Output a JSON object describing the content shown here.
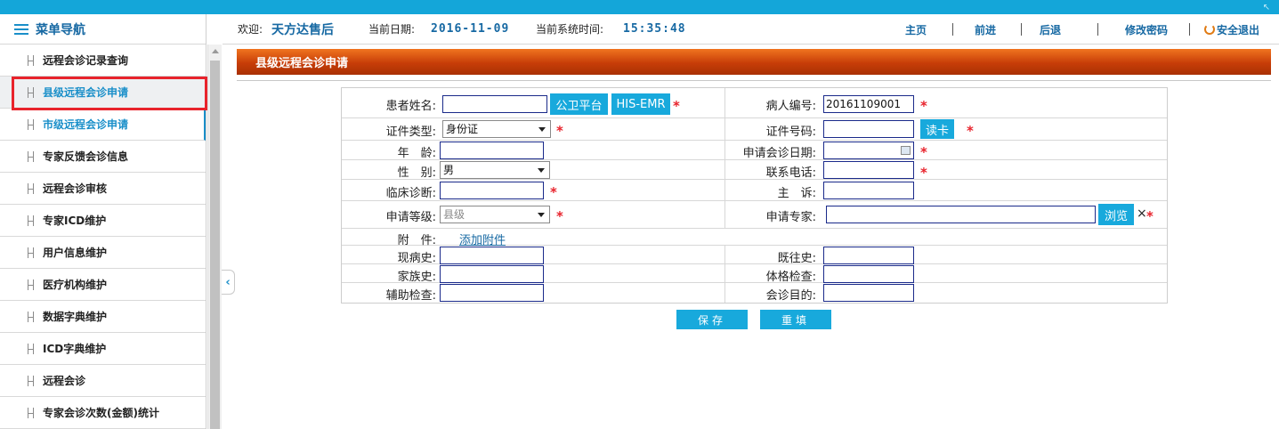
{
  "app": {
    "brand_color": "#14a6d9",
    "accent_color": "#1769a3",
    "required_color": "#e8232c",
    "title_bar_color": "#c73d08"
  },
  "sidebar": {
    "title": "菜单导航",
    "items": [
      {
        "label": "远程会诊记录查询"
      },
      {
        "label": "县级远程会诊申请"
      },
      {
        "label": "市级远程会诊申请"
      },
      {
        "label": "专家反馈会诊信息"
      },
      {
        "label": "远程会诊审核"
      },
      {
        "label": "专家ICD维护"
      },
      {
        "label": "用户信息维护"
      },
      {
        "label": "医疗机构维护"
      },
      {
        "label": "数据字典维护"
      },
      {
        "label": "ICD字典维护"
      },
      {
        "label": "远程会诊"
      },
      {
        "label": "专家会诊次数(金额)统计"
      }
    ]
  },
  "header": {
    "welcome_label": "欢迎:",
    "user": "天方达售后",
    "date_label": "当前日期:",
    "date": "2016-11-09",
    "time_label": "当前系统时间:",
    "time": "15:35:48",
    "nav": {
      "home": "主页",
      "forward": "前进",
      "back": "后退",
      "change_password": "修改密码",
      "logout": "安全退出"
    }
  },
  "page": {
    "title": "县级远程会诊申请"
  },
  "form": {
    "patient_name": {
      "label": "患者姓名:",
      "value": ""
    },
    "btn_gongwei": "公卫平台",
    "btn_his": "HIS-EMR",
    "patient_id": {
      "label": "病人编号:",
      "value": "20161109001"
    },
    "id_type": {
      "label": "证件类型:",
      "value": "身份证"
    },
    "id_number": {
      "label": "证件号码:",
      "value": ""
    },
    "btn_read_card": "读卡",
    "age": {
      "label": "年　龄:",
      "value": ""
    },
    "apply_date": {
      "label": "申请会诊日期:",
      "value": ""
    },
    "gender": {
      "label": "性　别:",
      "value": "男"
    },
    "phone": {
      "label": "联系电话:",
      "value": ""
    },
    "diagnosis": {
      "label": "临床诊断:",
      "value": ""
    },
    "complaint": {
      "label": "主　诉:",
      "value": ""
    },
    "level": {
      "label": "申请等级:",
      "value": "县级"
    },
    "expert": {
      "label": "申请专家:",
      "value": ""
    },
    "btn_browse": "浏览",
    "clear_mark": "×",
    "attachment": {
      "label": "附　件:",
      "link": "添加附件"
    },
    "present_history": {
      "label": "现病史:",
      "value": ""
    },
    "past_history": {
      "label": "既往史:",
      "value": ""
    },
    "family_history": {
      "label": "家族史:",
      "value": ""
    },
    "physical_exam": {
      "label": "体格检查:",
      "value": ""
    },
    "aux_exam": {
      "label": "辅助检查:",
      "value": ""
    },
    "purpose": {
      "label": "会诊目的:",
      "value": ""
    },
    "required_mark": "*"
  },
  "actions": {
    "save": "保存",
    "reset": "重填"
  }
}
